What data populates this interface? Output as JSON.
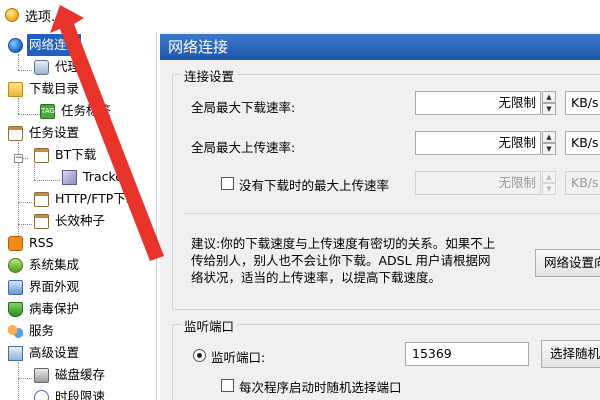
{
  "window": {
    "title": "选项..."
  },
  "tree": {
    "items": [
      {
        "label": "网络连接",
        "icon": "globe-icon"
      },
      {
        "label": "代理",
        "icon": "proxy-icon"
      },
      {
        "label": "下载目录",
        "icon": "folder-icon"
      },
      {
        "label": "任务标签",
        "icon": "tag-icon"
      },
      {
        "label": "任务设置",
        "icon": "clipboard-icon"
      },
      {
        "label": "BT下载",
        "icon": "clipboard-icon"
      },
      {
        "label": "Tracker",
        "icon": "cube-icon"
      },
      {
        "label": "HTTP/FTP下载",
        "icon": "clipboard-icon"
      },
      {
        "label": "长效种子",
        "icon": "clipboard-icon"
      },
      {
        "label": "RSS",
        "icon": "rss-icon"
      },
      {
        "label": "系统集成",
        "icon": "system-icon"
      },
      {
        "label": "界面外观",
        "icon": "appearance-icon"
      },
      {
        "label": "病毒保护",
        "icon": "shield-icon"
      },
      {
        "label": "服务",
        "icon": "service-icon"
      },
      {
        "label": "高级设置",
        "icon": "advanced-icon"
      },
      {
        "label": "磁盘缓存",
        "icon": "disk-icon"
      },
      {
        "label": "时段限速",
        "icon": "clock-icon"
      }
    ],
    "expander_minus": "−"
  },
  "panel": {
    "title": "网络连接",
    "connection": {
      "group_title": "连接设置",
      "max_download_label": "全局最大下载速率:",
      "max_download_value": "无限制",
      "max_upload_label": "全局最大上传速率:",
      "max_upload_value": "无限制",
      "idle_upload_label": "没有下载时的最大上传速率",
      "idle_upload_value": "无限制",
      "unit": "KB/s",
      "note_line1": "建议:你的下载速度与上传速度有密切的关系。如果不上",
      "note_line2": "传给别人，别人也不会让你下载。ADSL 用户请根据网",
      "note_line3": "络状况，适当的上传速率，以提高下载速度。",
      "wizard_button": "网络设置向导"
    },
    "listen": {
      "group_title": "监听端口",
      "port_label": "监听端口:",
      "port_value": "15369",
      "random_button": "选择随机端口",
      "random_on_start_label": "每次程序启动时随机选择端口"
    }
  },
  "spin_up": "▲",
  "spin_down": "▼"
}
